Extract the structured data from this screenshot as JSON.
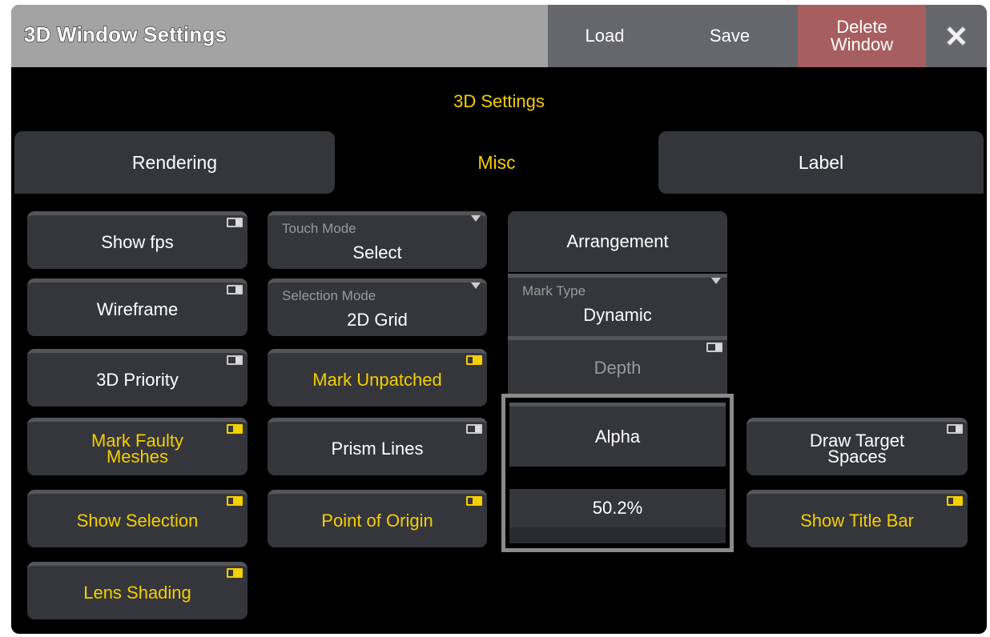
{
  "window": {
    "title": "3D Window Settings",
    "load_label": "Load",
    "save_label": "Save",
    "delete_label": "Delete\nWindow",
    "close_icon": "close-x-icon"
  },
  "section_title": "3D Settings",
  "tabs": [
    {
      "label": "Rendering",
      "active": false
    },
    {
      "label": "Misc",
      "active": true
    },
    {
      "label": "Label",
      "active": false
    }
  ],
  "col1": {
    "show_fps": {
      "label": "Show fps",
      "on": false
    },
    "wireframe": {
      "label": "Wireframe",
      "on": false
    },
    "priority": {
      "label": "3D Priority",
      "on": false
    },
    "mark_faulty": {
      "label": "Mark Faulty\nMeshes",
      "on": true
    },
    "show_selection": {
      "label": "Show Selection",
      "on": true
    },
    "lens_shading": {
      "label": "Lens Shading",
      "on": true
    }
  },
  "col2": {
    "touch_mode": {
      "label": "Touch Mode",
      "value": "Select"
    },
    "selection_mode": {
      "label": "Selection Mode",
      "value": "2D Grid"
    },
    "mark_unpatched": {
      "label": "Mark Unpatched",
      "on": true
    },
    "prism_lines": {
      "label": "Prism Lines",
      "on": false
    },
    "point_of_origin": {
      "label": "Point of Origin",
      "on": true
    }
  },
  "col3": {
    "arrangement": {
      "label": "Arrangement"
    },
    "mark_type": {
      "label": "Mark Type",
      "value": "Dynamic"
    },
    "depth": {
      "label": "Depth",
      "on": false
    },
    "alpha": {
      "label": "Alpha",
      "value": "50.2%"
    }
  },
  "col4": {
    "draw_target": {
      "label": "Draw Target\nSpaces",
      "on": false
    },
    "show_title_bar": {
      "label": "Show Title Bar",
      "on": true
    }
  },
  "colors": {
    "accent": "#f5cf00",
    "delete": "#a65e5f",
    "button": "#35363b"
  }
}
